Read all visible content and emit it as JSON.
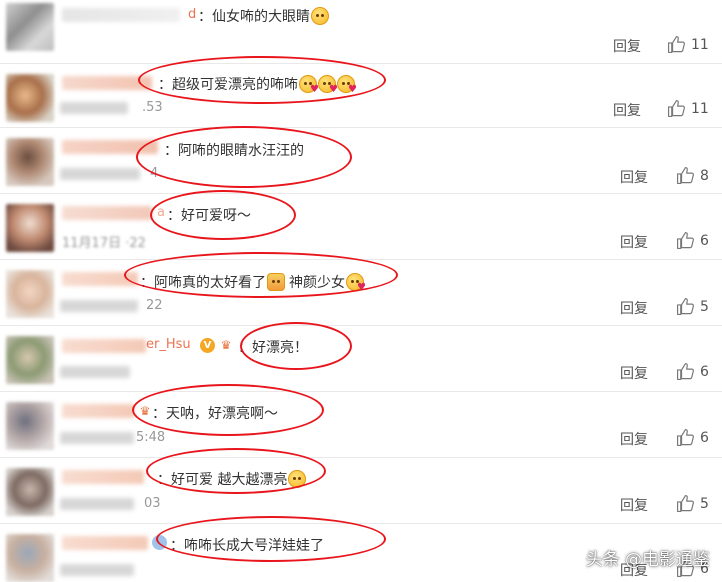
{
  "comments": [
    {
      "name_tail": "d",
      "name_tail_faded": false,
      "text": "：仙女咘的大眼睛",
      "emoji": [
        "plain"
      ],
      "time_tail": "",
      "reply": "回复",
      "likes": "11"
    },
    {
      "name_tail": "",
      "name_tail_faded": false,
      "text": "：超级可爱漂亮的咘咘",
      "emoji": [
        "heart",
        "heart",
        "heart"
      ],
      "time_tail": ".53",
      "reply": "回复",
      "likes": "11"
    },
    {
      "name_tail": "",
      "name_tail_faded": false,
      "text": "：阿咘的眼睛水汪汪的",
      "emoji": [],
      "time_tail": "4",
      "reply": "回复",
      "likes": "8"
    },
    {
      "name_tail": "a",
      "name_tail_faded": true,
      "text": "：好可爱呀～",
      "emoji": [],
      "time_tail": "11月17日 ·22",
      "reply": "回复",
      "likes": "6"
    },
    {
      "name_tail": "",
      "name_tail_faded": false,
      "text": "：阿咘真的太好看了",
      "emoji_mid": "baby",
      "text2": "神颜少女",
      "emoji": [
        "heart"
      ],
      "time_tail": "22",
      "reply": "回复",
      "likes": "5"
    },
    {
      "name_tail": "er_Hsu",
      "name_tail_faded": false,
      "text": "：好漂亮！",
      "emoji": [],
      "time_tail": "",
      "reply": "回复",
      "likes": "6",
      "vip": true
    },
    {
      "name_tail": "",
      "name_tail_faded": false,
      "text": "：天呐，好漂亮啊～",
      "emoji": [],
      "time_tail": "5:48",
      "reply": "回复",
      "likes": "6"
    },
    {
      "name_tail": "",
      "name_tail_faded": false,
      "text": "：好可爱 越大越漂亮",
      "emoji": [
        "cheeky"
      ],
      "time_tail": "03",
      "reply": "回复",
      "likes": "5"
    },
    {
      "name_tail": "",
      "name_tail_faded": false,
      "text": "：咘咘长成大号洋娃娃了",
      "emoji": [],
      "time_tail": "",
      "reply": "回复",
      "likes": "6"
    }
  ],
  "vip_badge": "V",
  "watermark": "头条 @电影通鉴",
  "colors": {
    "accent_circle": "#e8161c",
    "name_link": "#eb7350",
    "divider": "#e9e9e9"
  },
  "icons": {
    "like": "thumbs-up-icon",
    "vip": "vip-badge-icon",
    "crown": "crown-icon"
  }
}
